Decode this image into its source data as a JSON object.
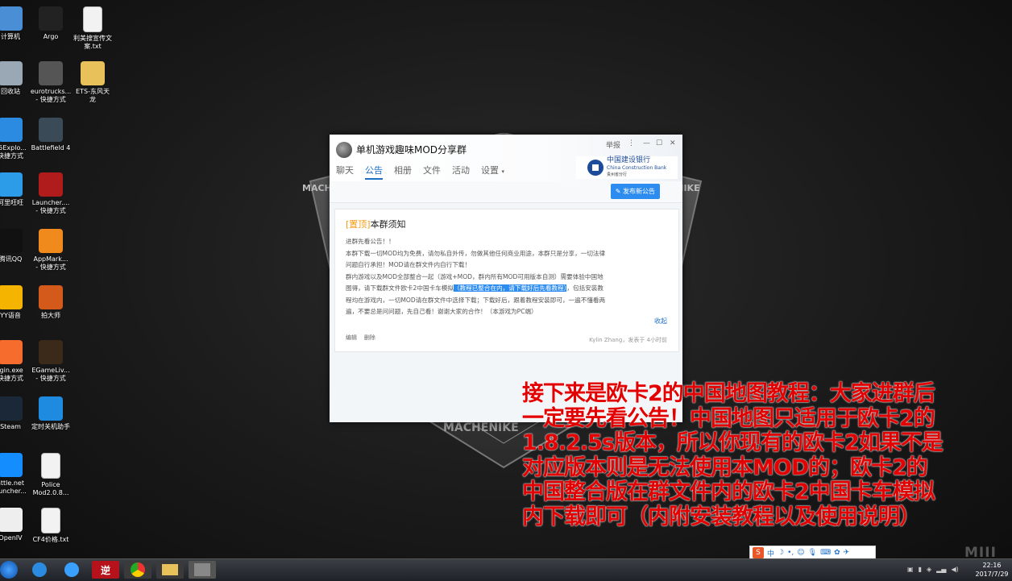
{
  "desktop_icons": [
    {
      "label": "计算机",
      "icon": "computer-icon"
    },
    {
      "label": "Argo",
      "icon": "argo-icon"
    },
    {
      "label": "利美搜宣传文\n案.txt",
      "icon": "text-file-icon"
    },
    {
      "label": "回收站",
      "icon": "recycle-bin-icon"
    },
    {
      "label": "eurotrucks...\n- 快捷方式",
      "icon": "eurotruck-icon"
    },
    {
      "label": "ETS-东风天\n龙",
      "icon": "folder-icon"
    },
    {
      "label": "45Explo...\n快捷方式",
      "icon": "ie-icon"
    },
    {
      "label": "Battlefield 4",
      "icon": "battlefield-icon"
    },
    {
      "label": "阿里旺旺",
      "icon": "wangwang-icon"
    },
    {
      "label": "Launcher....\n- 快捷方式",
      "icon": "3dm-icon"
    },
    {
      "label": "腾讯QQ",
      "icon": "qq-icon"
    },
    {
      "label": "AppMark...\n- 快捷方式",
      "icon": "appmarket-icon"
    },
    {
      "label": "YY语音",
      "icon": "yy-icon"
    },
    {
      "label": "拍大师",
      "icon": "paidashi-icon"
    },
    {
      "label": "igin.exe\n快捷方式",
      "icon": "origin-icon"
    },
    {
      "label": "EGameLiv...\n- 快捷方式",
      "icon": "egame-icon"
    },
    {
      "label": "Steam",
      "icon": "steam-icon"
    },
    {
      "label": "定时关机助手",
      "icon": "shutdown-icon"
    },
    {
      "label": "attle.net\nauncher...",
      "icon": "battlenet-icon"
    },
    {
      "label": "Police\nMod2.0.8...",
      "icon": "text-file-icon"
    },
    {
      "label": "OpenIV",
      "icon": "openiv-icon"
    },
    {
      "label": "CF4价格.txt",
      "icon": "text-file-icon"
    }
  ],
  "wallpaper": {
    "text": "MACHENIKE"
  },
  "qq_window": {
    "title": "单机游戏趣味MOD分享群",
    "report": "举报",
    "tabs": [
      "聊天",
      "公告",
      "相册",
      "文件",
      "活动",
      "设置"
    ],
    "active_tab": "公告",
    "bank": {
      "name": "中国建设银行",
      "en": "China Construction Bank",
      "branch": "贵州省分行"
    },
    "publish_button": "发布新公告",
    "notice": {
      "pin": "[置顶]",
      "title": "本群须知",
      "lines": [
        "进群先看公告！！",
        "本群下载一切MOD均为免费，请勿私自外传，勿做其他任何商业用途，本群只是分享，一切法律",
        "问题自行承担！MOD请在群文件内自行下载！",
        "群内游戏以及MOD全部整合一起（游戏+MOD，群内所有MOD可用版本自测）需要体验中国地",
        "图得，请下载群文件欧卡2中国卡车模拟",
        "，包括安装教",
        "程均在游戏内，一切MOD请在群文件中选择下载；下载好后，跟着教程安装即可，一遍不懂看两",
        "遍，不要总是问问题，先自己看！谢谢大家的合作！（本游戏为PC端）"
      ],
      "highlight": "（教程已整合在内，请下载好后先看教程）",
      "collapse": "收起",
      "edit": "编辑",
      "delete": "删除",
      "meta": "Kylin Zhang，发表于 4小时前"
    }
  },
  "overlay_lines": [
    "接下来是欧卡2的中国地图教程：大家进群后",
    "一定要先看公告！中国地图只适用于欧卡2的",
    "1.8.2.5s版本，所以你现有的欧卡2如果不是",
    "对应版本则是无法使用本MOD的；欧卡2的",
    "中国整合版在群文件内的欧卡2中国卡车模拟",
    "内下载即可（内附安装教程以及使用说明）"
  ],
  "ime": {
    "logo": "S",
    "mode": "中"
  },
  "taskbar": {
    "buttons": [
      "ie-icon",
      "browser-icon",
      "ni-app-icon",
      "chrome-icon",
      "explorer-icon",
      "game-icon"
    ],
    "ni_label": "逆",
    "time": "22:16",
    "date": "2017/7/29"
  },
  "watermark": "MIII"
}
